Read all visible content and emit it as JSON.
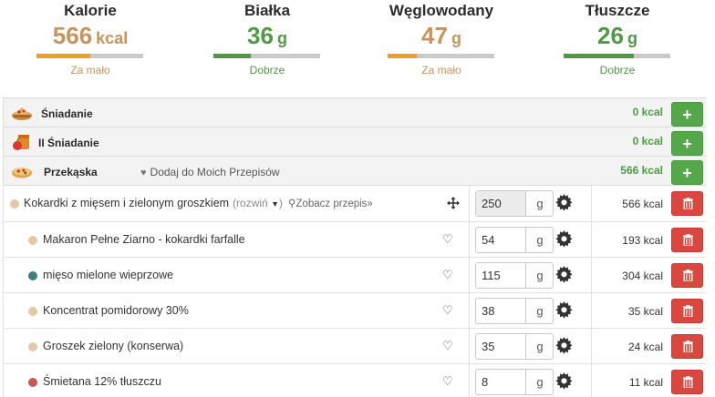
{
  "macros": {
    "kalorie": {
      "name": "Kalorie",
      "value": "566",
      "unit": "kcal",
      "status": "Za mało",
      "progress": 0.5
    },
    "bialka": {
      "name": "Białka",
      "value": "36",
      "unit": "g",
      "status": "Dobrze",
      "progress": 0.35
    },
    "weglowodany": {
      "name": "Węglowodany",
      "value": "47",
      "unit": "g",
      "status": "Za mało",
      "progress": 0.27
    },
    "tluszcze": {
      "name": "Tłuszcze",
      "value": "26",
      "unit": "g",
      "status": "Dobrze",
      "progress": 0.66
    }
  },
  "colors": {
    "low": "#f0a020",
    "ok": "#4b9b42",
    "add_button": "#55a84a",
    "delete_button": "#d9473f"
  },
  "meals": [
    {
      "name": "Śniadanie",
      "kcal": "0 kcal",
      "icon": "breakfast-icon"
    },
    {
      "name": "II Śniadanie",
      "kcal": "0 kcal",
      "icon": "second-breakfast-icon"
    },
    {
      "name": "Przekąska",
      "kcal": "566 kcal",
      "icon": "snack-icon",
      "favorite_label": "Dodaj do Moich Przepisów"
    }
  ],
  "recipe": {
    "name": "Kokardki z mięsem i zielonym groszkiem",
    "expand_label": "(rozwiń",
    "view_label": "Zobacz przepis»",
    "qty": "250",
    "unit": "g",
    "kcal": "566 kcal"
  },
  "ingredients": [
    {
      "name": "Makaron Pełne Ziarno - kokardki farfalle",
      "qty": "54",
      "unit": "g",
      "kcal": "193 kcal",
      "dot": "#e3c9a8"
    },
    {
      "name": "mięso mielone wieprzowe",
      "qty": "115",
      "unit": "g",
      "kcal": "304 kcal",
      "dot": "#3f7f77"
    },
    {
      "name": "Koncentrat pomidorowy 30%",
      "qty": "38",
      "unit": "g",
      "kcal": "35 kcal",
      "dot": "#e3c9a8"
    },
    {
      "name": "Groszek zielony (konserwa)",
      "qty": "35",
      "unit": "g",
      "kcal": "24 kcal",
      "dot": "#e3c9a8"
    },
    {
      "name": "Śmietana 12% tłuszczu",
      "qty": "8",
      "unit": "g",
      "kcal": "11 kcal",
      "dot": "#c9575a"
    }
  ]
}
